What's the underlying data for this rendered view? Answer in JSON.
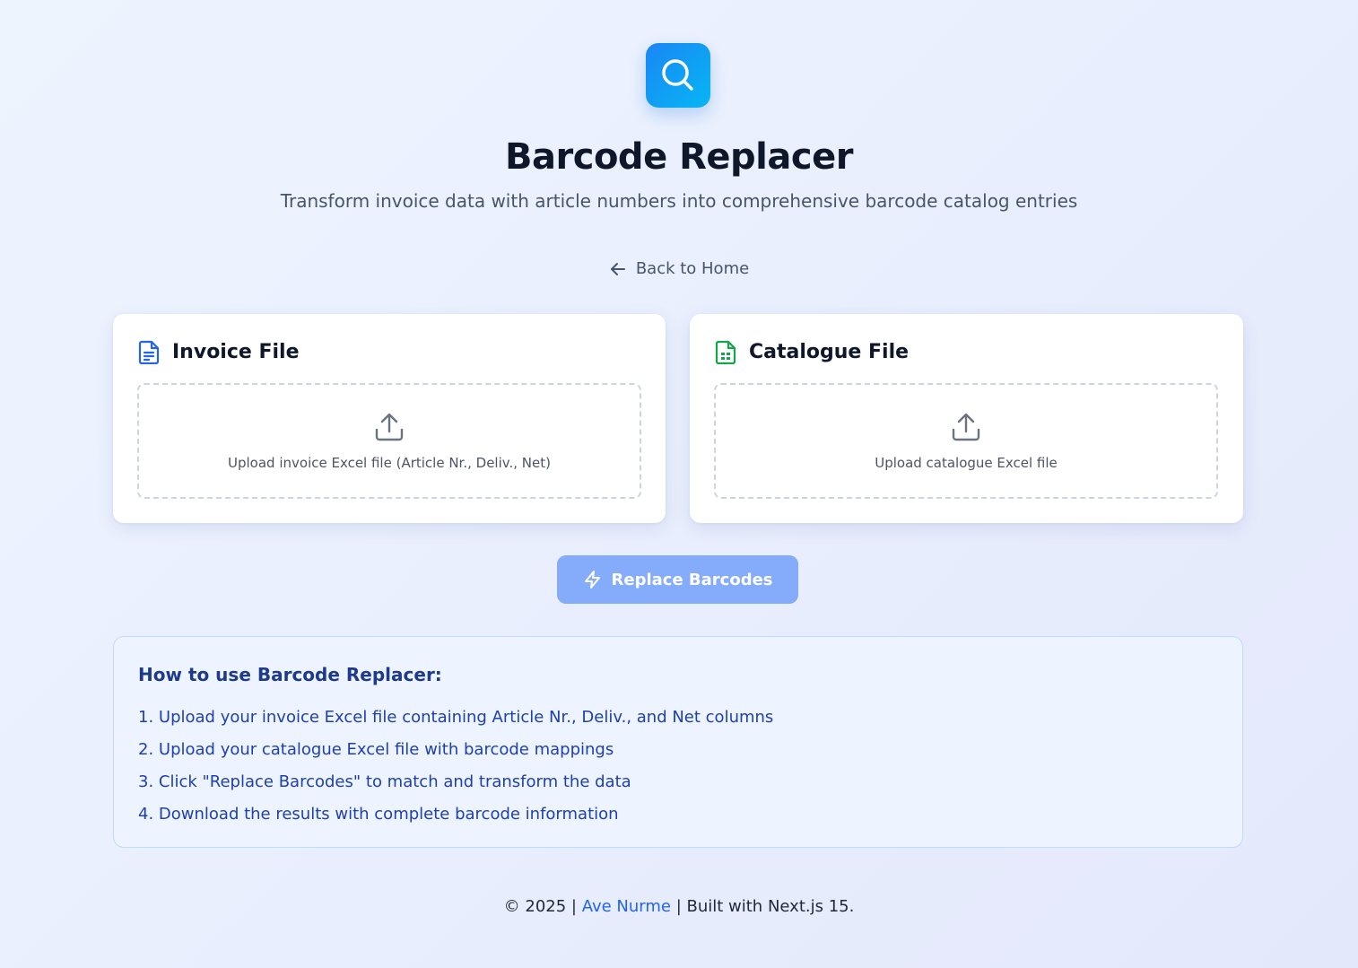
{
  "header": {
    "logo_icon": "search-icon",
    "title": "Barcode Replacer",
    "subtitle": "Transform invoice data with article numbers into comprehensive barcode catalog entries"
  },
  "nav": {
    "back_icon": "arrow-left-icon",
    "back_label": "Back to Home"
  },
  "cards": {
    "invoice": {
      "icon": "document-icon",
      "title": "Invoice File",
      "upload_icon": "upload-icon",
      "upload_text": "Upload invoice Excel file (Article Nr., Deliv., Net)"
    },
    "catalogue": {
      "icon": "spreadsheet-icon",
      "title": "Catalogue File",
      "upload_icon": "upload-icon",
      "upload_text": "Upload catalogue Excel file"
    }
  },
  "actions": {
    "replace_icon": "lightning-icon",
    "replace_label": "Replace Barcodes"
  },
  "help": {
    "title": "How to use Barcode Replacer:",
    "steps": [
      "1. Upload your invoice Excel file containing Article Nr., Deliv., and Net columns",
      "2. Upload your catalogue Excel file with barcode mappings",
      "3. Click \"Replace Barcodes\" to match and transform the data",
      "4. Download the results with complete barcode information"
    ]
  },
  "footer": {
    "prefix": "© 2025 | ",
    "author": "Ave Nurme",
    "suffix": " | Built with Next.js 15."
  },
  "colors": {
    "brand_gradient_start": "#1a86f5",
    "brand_gradient_end": "#06b6f4",
    "invoice_icon": "#2563eb",
    "catalogue_icon": "#16a34a",
    "button_disabled": "#85abfb",
    "help_text": "#1e40af",
    "link": "#2563eb"
  }
}
